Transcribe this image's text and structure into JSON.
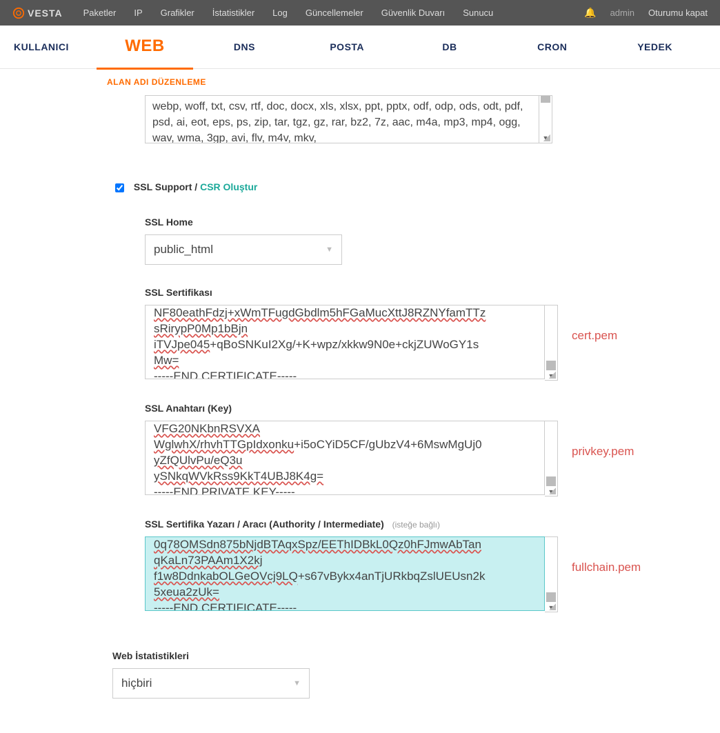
{
  "top": {
    "brand": "VESTA",
    "menu": [
      "Paketler",
      "IP",
      "Grafikler",
      "İstatistikler",
      "Log",
      "Güncellemeler",
      "Güvenlik Duvarı",
      "Sunucu"
    ],
    "admin": "admin",
    "logout": "Oturumu kapat"
  },
  "nav": [
    "KULLANICI",
    "WEB",
    "DNS",
    "POSTA",
    "DB",
    "CRON",
    "YEDEK"
  ],
  "subnav": "ALAN ADI DÜZENLEME",
  "ext_value": "webp, woff, txt, csv, rtf, doc, docx, xls, xlsx, ppt, pptx, odf, odp, ods, odt, pdf, psd, ai, eot, eps, ps, zip, tar, tgz, gz, rar, bz2, 7z, aac, m4a, mp3, mp4, ogg, wav, wma, 3gp, avi, flv, m4v, mkv,",
  "ssl": {
    "support_label": "SSL Support / ",
    "csr": "CSR Oluştur",
    "home_label": "SSL Home",
    "home_value": "public_html",
    "cert_label": "SSL Sertifikası",
    "cert_line1": "NF80eathFdzj+xWmTFugdGbdlm5hFGaMucXttJ8RZNYfamTTz",
    "cert_line2a": "sRirypP0Mp1bBjn",
    "cert_line3a": "iTVJpe045",
    "cert_line3b": "+qBoSNKuI2Xg/+K+wpz/xkkw9N0e+ckjZUWoGY1s",
    "cert_line4": "Mw=",
    "cert_end": "-----END CERTIFICATE-----",
    "cert_side": "cert.pem",
    "key_label": "SSL Anahtarı (Key)",
    "key_line1": "VFG20NKbnRSVXA",
    "key_line2a": "WglwhX/rhvhTTGpIdxonku",
    "key_line2b": "+i5oCYiD5CF/gUbzV4+6MswMgUj0",
    "key_line3": "yZfQUlvPu/eQ3u",
    "key_line4": "ySNkqWVkRss9KkT4UBJ8K4g=",
    "key_end": "-----END PRIVATE KEY-----",
    "key_side": "privkey.pem",
    "auth_label": "SSL Sertifika Yazarı / Aracı (Authority / Intermediate) ",
    "auth_opt": "(isteğe bağlı)",
    "auth_line1": "0q78OMSdn875bNjdBTAqxSpz/EEThIDBkL0Qz0hFJmwAbTan",
    "auth_line2": "qKaLn73PAAm1X2kj",
    "auth_line3a": "f1w8DdnkabOLGeOVcj9LQ",
    "auth_line3b": "+s67vBykx4anTjURkbqZslUEUsn2k",
    "auth_line4": "5xeua2zUk=",
    "auth_end": "-----END CERTIFICATE-----",
    "auth_side": "fullchain.pem"
  },
  "stats": {
    "label": "Web İstatistikleri",
    "value": "hiçbiri"
  }
}
